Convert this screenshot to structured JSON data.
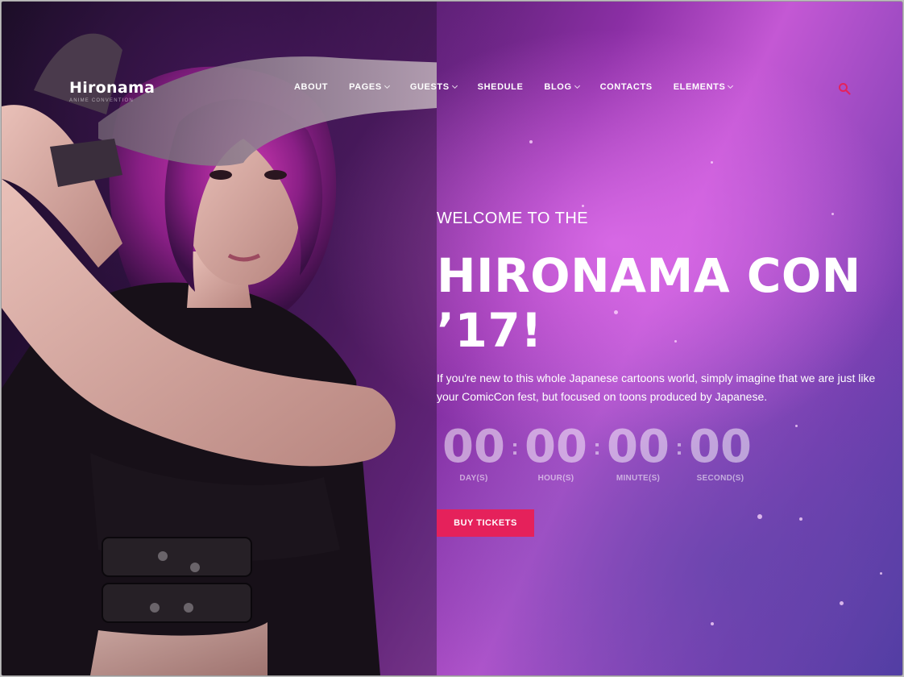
{
  "brand": {
    "name": "Hironama",
    "tagline": "ANIME CONVENTION"
  },
  "nav": [
    {
      "label": "ABOUT",
      "has_dropdown": false
    },
    {
      "label": "PAGES",
      "has_dropdown": true
    },
    {
      "label": "GUESTS",
      "has_dropdown": true
    },
    {
      "label": "SHEDULE",
      "has_dropdown": false
    },
    {
      "label": "BLOG",
      "has_dropdown": true
    },
    {
      "label": "CONTACTS",
      "has_dropdown": false
    },
    {
      "label": "ELEMENTS",
      "has_dropdown": true
    }
  ],
  "search_icon": "search-icon",
  "hero": {
    "eyebrow": "WELCOME TO THE",
    "title_line1": "HIRONAMA CON",
    "title_line2": "’17!",
    "description": "If you're new to this whole Japanese cartoons world, simply imagine that we are just like your ComicCon fest, but focused on toons produced by Japanese.",
    "countdown": [
      {
        "value": "00",
        "label": "DAY(S)"
      },
      {
        "value": "00",
        "label": "HOUR(S)"
      },
      {
        "value": "00",
        "label": "MINUTE(S)"
      },
      {
        "value": "00",
        "label": "SECOND(S)"
      }
    ],
    "separator": ":",
    "cta": "BUY TICKETS"
  },
  "colors": {
    "accent": "#e5215b",
    "search": "#e5215b",
    "hero_glow": "#c458d4",
    "dark": "#1a0f26"
  }
}
